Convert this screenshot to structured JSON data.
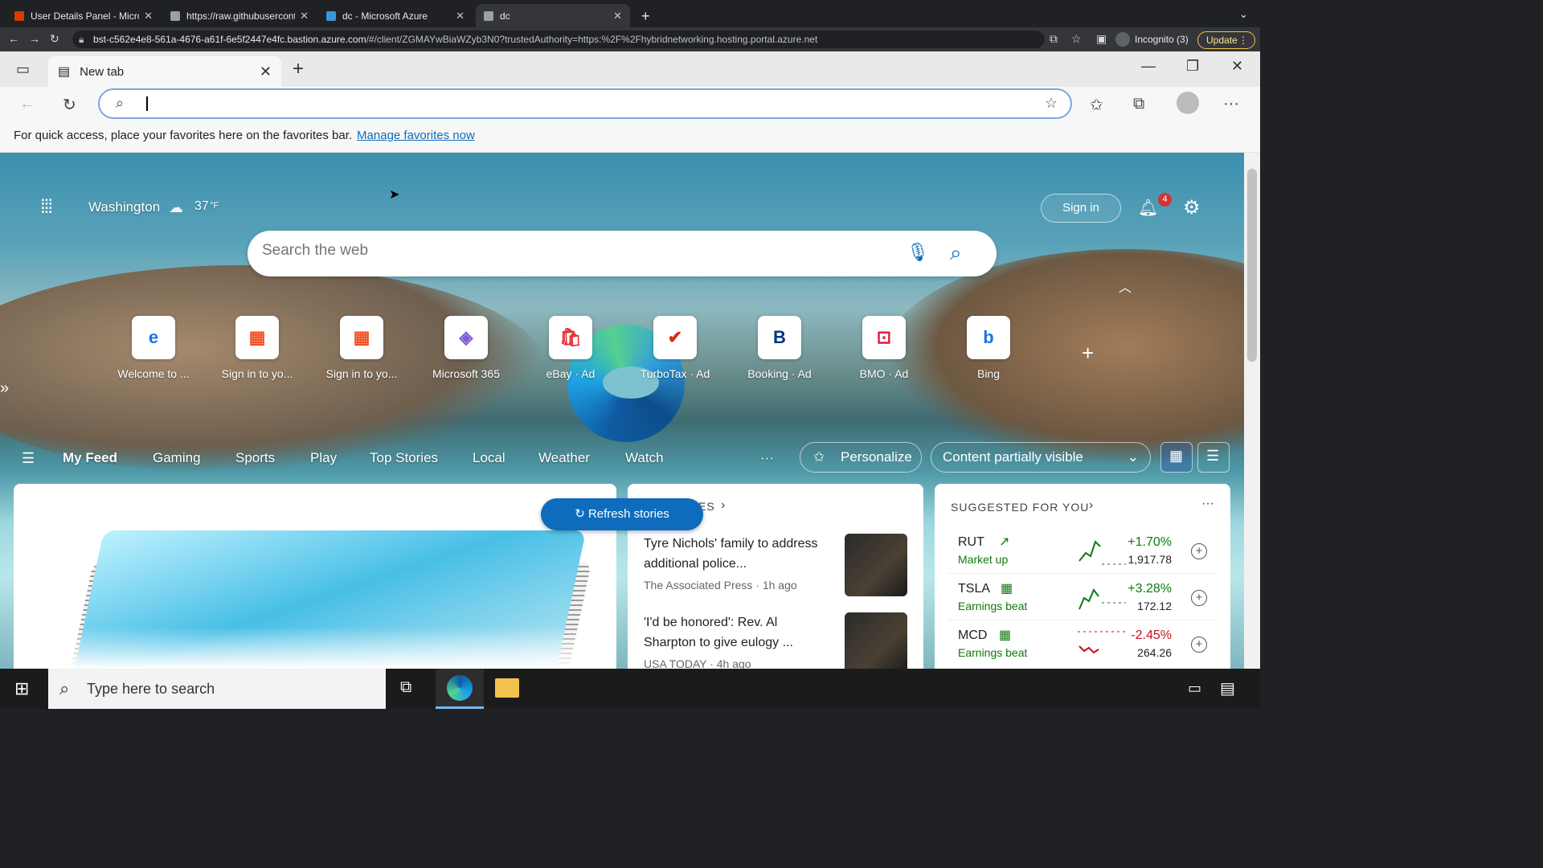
{
  "chrome": {
    "tabs": [
      {
        "title": "User Details Panel - Microsoft",
        "color": "#d83b01"
      },
      {
        "title": "https://raw.githubusercontent.",
        "color": "#9aa0a6"
      },
      {
        "title": "dc - Microsoft Azure",
        "color": "#3a96dd"
      },
      {
        "title": "dc",
        "color": "#9aa0a6"
      }
    ],
    "url_host": "bst-c562e4e8-561a-4676-a61f-6e5f2447e4fc.bastion.azure.com",
    "url_rest": "/#/client/ZGMAYwBiaWZyb3N0?trustedAuthority=https:%2F%2Fhybridnetworking.hosting.portal.azure.net",
    "incognito": "Incognito (3)",
    "update": "Update"
  },
  "edge": {
    "tab_title": "New tab",
    "favbar_text": "For quick access, place your favorites here on the favorites bar.",
    "favbar_link": "Manage favorites now"
  },
  "ntp": {
    "location": "Washington",
    "temp": "37",
    "unit": "°F",
    "sign_in": "Sign in",
    "notif_count": "4",
    "search_placeholder": "Search the web",
    "quicklinks": [
      {
        "label": "Welcome to ...",
        "glyph": "e",
        "color": "#1a73e8"
      },
      {
        "label": "Sign in to yo...",
        "glyph": "▦",
        "color": "#f25022"
      },
      {
        "label": "Sign in to yo...",
        "glyph": "▦",
        "color": "#f25022"
      },
      {
        "label": "Microsoft 365",
        "glyph": "◈",
        "color": "#7b5bd6"
      },
      {
        "label": "eBay · Ad",
        "glyph": "🛍",
        "color": "#e53238"
      },
      {
        "label": "TurboTax · Ad",
        "glyph": "✔",
        "color": "#d52b1e"
      },
      {
        "label": "Booking · Ad",
        "glyph": "B",
        "color": "#003580"
      },
      {
        "label": "BMO · Ad",
        "glyph": "⊡",
        "color": "#e31837"
      },
      {
        "label": "Bing",
        "glyph": "b",
        "color": "#1a73e8"
      }
    ],
    "feed_tabs": [
      "My Feed",
      "Gaming",
      "Sports",
      "Play",
      "Top Stories",
      "Local",
      "Weather",
      "Watch"
    ],
    "more": "···",
    "personalize": "Personalize",
    "content_visibility": "Content partially visible",
    "refresh": "Refresh stories",
    "top_stories_label": "ES",
    "stories": [
      {
        "headline": "Tyre Nichols' family to address additional police...",
        "source": "The Associated Press · 1h ago"
      },
      {
        "headline": "'I'd be honored': Rev. Al Sharpton to give eulogy ...",
        "source": "USA TODAY · 4h ago"
      }
    ],
    "suggested_title": "SUGGESTED FOR YOU",
    "stocks": [
      {
        "symbol": "RUT",
        "note": "Market up",
        "change": "+1.70%",
        "price": "1,917.78",
        "dir": "up"
      },
      {
        "symbol": "TSLA",
        "note": "Earnings beat",
        "change": "+3.28%",
        "price": "172.12",
        "dir": "up"
      },
      {
        "symbol": "MCD",
        "note": "Earnings beat",
        "change": "-2.45%",
        "price": "264.26",
        "dir": "down"
      }
    ]
  },
  "taskbar": {
    "search_placeholder": "Type here to search"
  }
}
